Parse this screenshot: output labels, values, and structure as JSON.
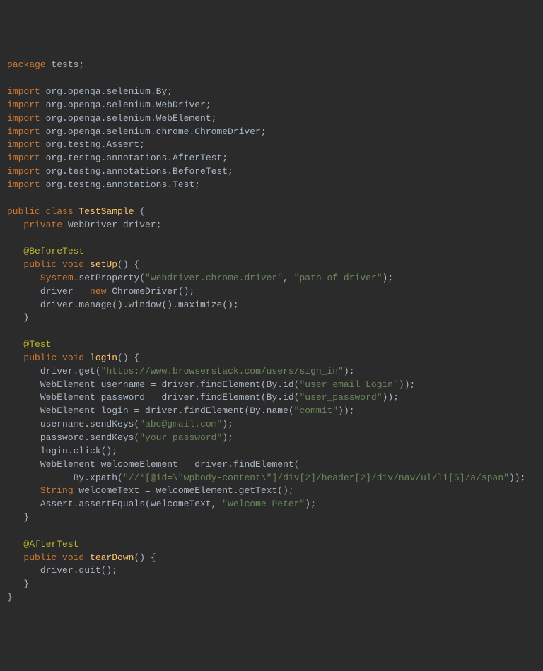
{
  "code": {
    "line1": {
      "kw1": "package",
      "pkg": " tests;"
    },
    "blank1": "",
    "imp1": {
      "kw": "import",
      "txt": " org.openqa.selenium.By;"
    },
    "imp2": {
      "kw": "import",
      "txt": " org.openqa.selenium.WebDriver;"
    },
    "imp3": {
      "kw": "import",
      "txt": " org.openqa.selenium.WebElement;"
    },
    "imp4": {
      "kw": "import",
      "txt": " org.openqa.selenium.chrome.ChromeDriver;"
    },
    "imp5": {
      "kw": "import",
      "txt": " org.testng.Assert;"
    },
    "imp6": {
      "kw": "import",
      "txt": " org.testng.annotations.AfterTest;"
    },
    "imp7": {
      "kw": "import",
      "txt": " org.testng.annotations.BeforeTest;"
    },
    "imp8": {
      "kw": "import",
      "txt": " org.testng.annotations.Test;"
    },
    "blank2": "",
    "clsDecl": {
      "pub": "public",
      "cls": " class ",
      "name": "TestSample",
      "brace": " {"
    },
    "fld": {
      "indent": "   ",
      "priv": "private",
      "type": " WebDriver driver;"
    },
    "blank3": "",
    "ann1": {
      "indent": "   ",
      "ann": "@BeforeTest"
    },
    "m1": {
      "indent": "   ",
      "pub": "public",
      "void": " void ",
      "name": "setUp",
      "rest": "() {"
    },
    "m1b1": {
      "indent": "      ",
      "sys": "System",
      "dot": ".setProperty(",
      "s1": "\"webdriver.chrome.driver\"",
      "comma": ", ",
      "s2": "\"path of driver\"",
      "close": ");"
    },
    "m1b2": {
      "indent": "      ",
      "txt1": "driver = ",
      "kw": "new",
      "txt2": " ChromeDriver();"
    },
    "m1b3": {
      "indent": "      ",
      "txt": "driver.manage().window().maximize();"
    },
    "m1close": {
      "indent": "   ",
      "txt": "}"
    },
    "blank4": "",
    "ann2": {
      "indent": "   ",
      "ann": "@Test"
    },
    "m2": {
      "indent": "   ",
      "pub": "public",
      "void": " void ",
      "name": "login",
      "rest": "() {"
    },
    "m2b1": {
      "indent": "      ",
      "txt1": "driver.get(",
      "s1": "\"https://www.browserstack.com/users/sign_in\"",
      "txt2": ");"
    },
    "m2b2": {
      "indent": "      ",
      "txt1": "WebElement username = driver.findElement(By.id(",
      "s1": "\"user_email_Login\"",
      "txt2": "));"
    },
    "m2b3": {
      "indent": "      ",
      "txt1": "WebElement password = driver.findElement(By.id(",
      "s1": "\"user_password\"",
      "txt2": "));"
    },
    "m2b4": {
      "indent": "      ",
      "txt1": "WebElement login = driver.findElement(By.name(",
      "s1": "\"commit\"",
      "txt2": "));"
    },
    "m2b5": {
      "indent": "      ",
      "txt1": "username.sendKeys(",
      "s1": "\"abc@gmail.com\"",
      "txt2": ");"
    },
    "m2b6": {
      "indent": "      ",
      "txt1": "password.sendKeys(",
      "s1": "\"your_password\"",
      "txt2": ");"
    },
    "m2b7": {
      "indent": "      ",
      "txt": "login.click();"
    },
    "m2b8": {
      "indent": "      ",
      "txt": "WebElement welcomeElement = driver.findElement("
    },
    "m2b9": {
      "indent": "            ",
      "txt1": "By.xpath(",
      "s1": "\"//*[@id=\\\"wpbody-content\\\"]/div[2]/header[2]/div/nav/ul/li[5]/a/span\"",
      "txt2": "));"
    },
    "m2b10": {
      "indent": "      ",
      "kw": "String",
      "txt": " welcomeText = welcomeElement.getText();"
    },
    "m2b11": {
      "indent": "      ",
      "txt1": "Assert.assertEquals(welcomeText, ",
      "s1": "\"Welcome Peter\"",
      "txt2": ");"
    },
    "m2close": {
      "indent": "   ",
      "txt": "}"
    },
    "blank5": "",
    "ann3": {
      "indent": "   ",
      "ann": "@AfterTest"
    },
    "m3": {
      "indent": "   ",
      "pub": "public",
      "void": " void ",
      "name": "tearDown",
      "rest": "() {"
    },
    "m3b1": {
      "indent": "      ",
      "txt": "driver.quit();"
    },
    "m3close": {
      "indent": "   ",
      "txt": "}"
    },
    "clsClose": {
      "txt": "}"
    }
  }
}
